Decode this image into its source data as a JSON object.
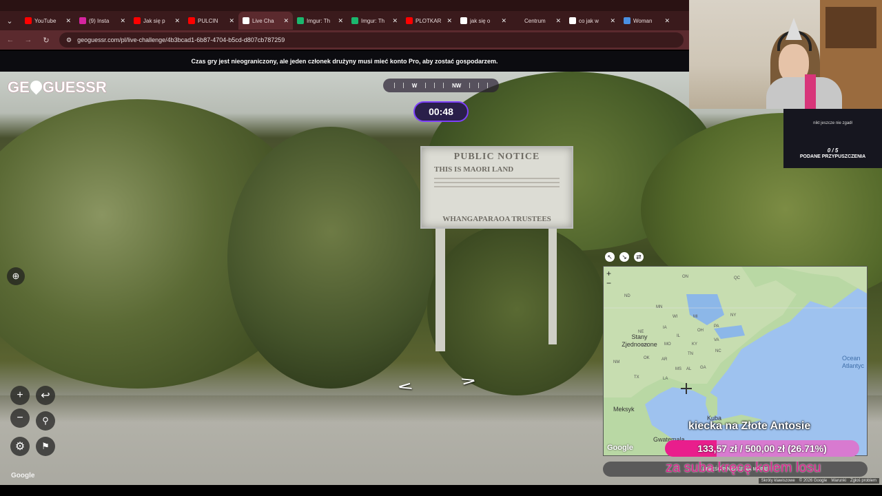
{
  "browser": {
    "tabs": [
      {
        "label": "YouTube",
        "color": "#ff0000",
        "active": false
      },
      {
        "label": "(9) Insta",
        "color": "#d6249f",
        "active": false
      },
      {
        "label": "Jak się p",
        "color": "#ff0000",
        "active": false
      },
      {
        "label": "PULCIN",
        "color": "#ff0000",
        "active": false
      },
      {
        "label": "Live Cha",
        "color": "#ffffff",
        "active": true
      },
      {
        "label": "Imgur: Th",
        "color": "#1bb76e",
        "active": false
      },
      {
        "label": "Imgur: Th",
        "color": "#1bb76e",
        "active": false
      },
      {
        "label": "PLOTKAR",
        "color": "#ff0000",
        "active": false
      },
      {
        "label": "jak się o",
        "color": "#ffffff",
        "active": false
      },
      {
        "label": "Centrum",
        "color": "#3a1a1c",
        "active": false
      },
      {
        "label": "co jak w",
        "color": "#ffffff",
        "active": false
      },
      {
        "label": "Woman",
        "color": "#4a90e2",
        "active": false
      }
    ],
    "url": "geoguessr.com/pl/live-challenge/4b3bcad1-6b87-4704-b5cd-d807cb787259"
  },
  "banner": "Czas gry jest nieograniczony, ale jeden członek drużyny musi mieć konto Pro, aby zostać gospodarzem.",
  "logo": {
    "left": "GE",
    "right": "GUESSR"
  },
  "compass": {
    "w": "W",
    "nw": "NW"
  },
  "timer": "00:48",
  "street_sign": {
    "line1": "PUBLIC NOTICE",
    "line2": "THIS IS MAORI LAND",
    "line3": "WHANGAPARAOA TRUSTEES"
  },
  "streetview_google": "Google",
  "map": {
    "labels": {
      "us": "Stany Zjednoczone",
      "mexico": "Meksyk",
      "cuba": "Kuba",
      "guatemala": "Gwatemala",
      "ocean": "Ocean Atlantyc",
      "qc": "QC",
      "on": "ON",
      "mn": "MN",
      "nd": "ND",
      "wi": "WI",
      "mi": "MI",
      "ia": "IA",
      "il": "IL",
      "oh": "OH",
      "pa": "PA",
      "ny": "NY",
      "ne": "NE",
      "ks": "KS",
      "mo": "MO",
      "ky": "KY",
      "va": "VA",
      "nc": "NC",
      "tn": "TN",
      "ok": "OK",
      "ar": "AR",
      "ms": "MS",
      "al": "AL",
      "ga": "GA",
      "tx": "TX",
      "nm": "NM",
      "la": "LA"
    },
    "zoom_plus": "+",
    "zoom_minus": "−",
    "google": "Google",
    "guess_button": "UMIEŚĆ PINEZKĘ NA MAPIE"
  },
  "goal": {
    "title": "kiecka na Złote Antosie",
    "amount": "133,57 zł / 500,00 zł (26.71%)",
    "percent": 26.71,
    "subtitle": "za suba kręcę kolem losu"
  },
  "side": {
    "message": "nikt jeszcze nie zgadł",
    "count": "0 / 5",
    "label": "PODANE PRZYPUSZCZENIA"
  },
  "footer_links": [
    "Skróty klawiszowe",
    "© 2026 Google",
    "Warunki",
    "Zgłoś problem"
  ],
  "colors": {
    "accent": "#7d3ffb",
    "goal": "#e91e8c",
    "brand": "#b11c4e"
  }
}
